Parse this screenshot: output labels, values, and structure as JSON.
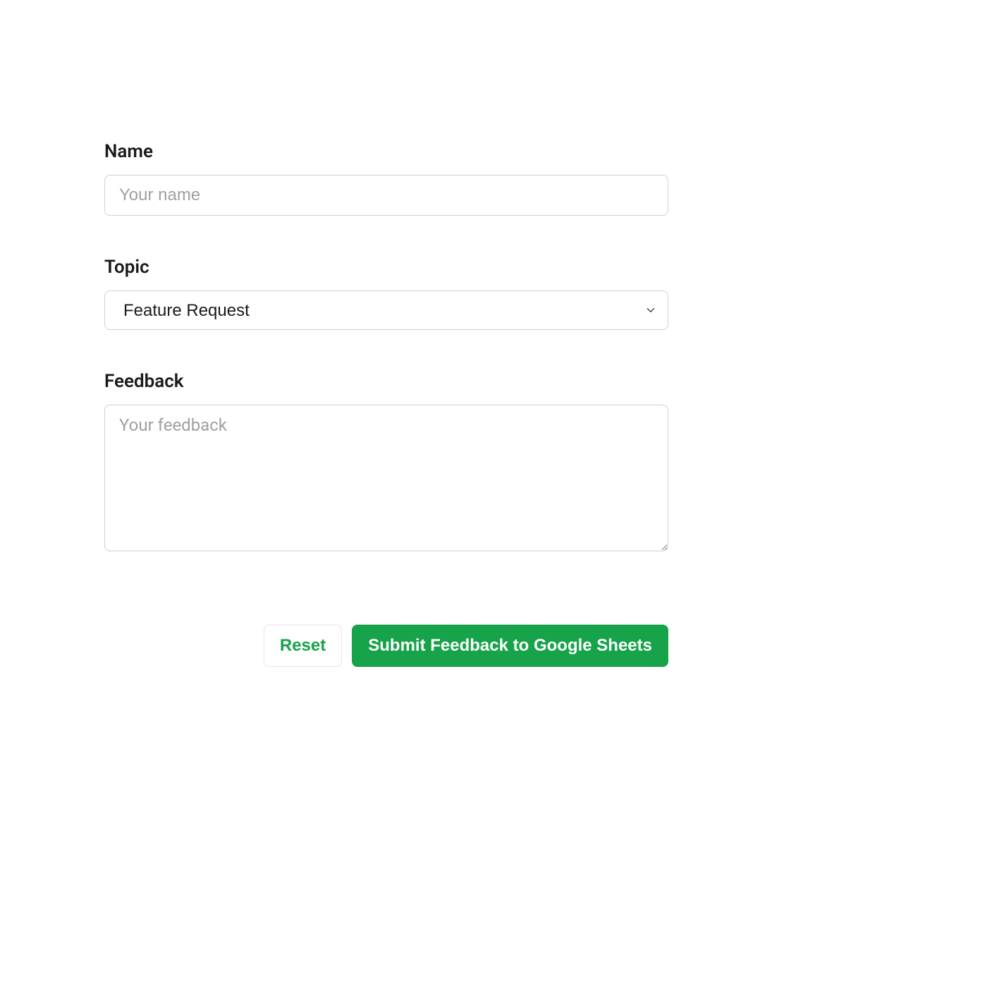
{
  "form": {
    "name": {
      "label": "Name",
      "placeholder": "Your name",
      "value": ""
    },
    "topic": {
      "label": "Topic",
      "selected": "Feature Request"
    },
    "feedback": {
      "label": "Feedback",
      "placeholder": "Your feedback",
      "value": ""
    },
    "buttons": {
      "reset": "Reset",
      "submit": "Submit Feedback to Google Sheets"
    }
  },
  "colors": {
    "accent": "#16a34a",
    "border": "#d0d0d0",
    "placeholder": "#a0a0a0",
    "text": "#1a1a1a"
  }
}
